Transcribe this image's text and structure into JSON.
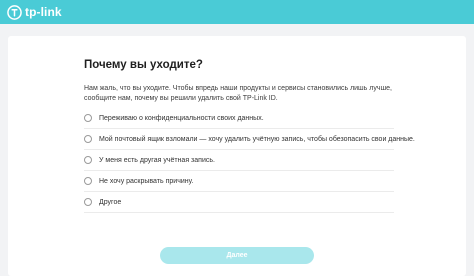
{
  "brand": {
    "name": "tp-link",
    "color": "#4acbd6"
  },
  "page": {
    "title": "Почему вы уходите?",
    "description": "Нам жаль, что вы уходите. Чтобы впредь наши продукты и сервисы становились лишь лучше, сообщите нам, почему вы решили удалить свой TP-Link ID.",
    "options": [
      {
        "label": "Переживаю о конфиденциальности своих данных."
      },
      {
        "label": "Мой почтовый ящик взломали — хочу удалить учётную запись, чтобы обезопасить свои данные."
      },
      {
        "label": "У меня есть другая учётная запись."
      },
      {
        "label": "Не хочу раскрывать причину."
      },
      {
        "label": "Другое"
      }
    ],
    "submit_label": "Далее"
  }
}
